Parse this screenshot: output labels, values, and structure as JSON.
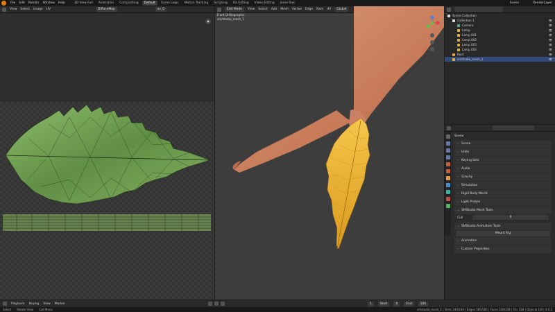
{
  "menu": [
    "File",
    "Edit",
    "Render",
    "Window",
    "Help"
  ],
  "workspaces": [
    "3D View Full",
    "Animation",
    "Compositing",
    "Default",
    "Game Logic",
    "Motion Tracking",
    "Scripting",
    "UV Editing",
    "Video Editing",
    "Jesse-Tool"
  ],
  "scene_label": "Scene",
  "view_layer": "RenderLayer",
  "uv_editor": {
    "menu": [
      "View",
      "Select",
      "Image",
      "UV"
    ],
    "image_name": "DiffuseMap",
    "uv_map": "uv_0"
  },
  "viewport": {
    "mode": "Edit Mode",
    "menu": [
      "View",
      "Select",
      "Add",
      "Mesh",
      "Vertex",
      "Edge",
      "Face",
      "UV"
    ],
    "orientation": "Global",
    "view_name": "Front Orthographic",
    "object_name": "sm/studio_mesh_1"
  },
  "outliner": {
    "rows": [
      {
        "label": "Scene Collection",
        "indent": 0
      },
      {
        "label": "Collection 1",
        "indent": 1
      },
      {
        "label": "Camera",
        "indent": 2
      },
      {
        "label": "Lamp",
        "indent": 2
      },
      {
        "label": "Lamp.001",
        "indent": 2
      },
      {
        "label": "Lamp.002",
        "indent": 2
      },
      {
        "label": "Lamp.003",
        "indent": 2
      },
      {
        "label": "Lamp.004",
        "indent": 2
      },
      {
        "label": "Root",
        "indent": 1
      },
      {
        "label": "smstudio_mesh_1",
        "indent": 1
      }
    ]
  },
  "properties": {
    "title": "Scene",
    "panels": [
      "Scene",
      "Units",
      "Keying Sets",
      "Audio",
      "Gravity",
      "Simulation",
      "Rigid Body World",
      "Light Probes",
      "SMStudio Mesh Tools"
    ],
    "cull_label": "Cull",
    "cull_value": "0",
    "anim_panel": "SMStudio Animation Tools",
    "mount_rig": "Mount Rig",
    "panels_after": [
      "Animation",
      "Custom Properties"
    ]
  },
  "timeline": {
    "items": [
      "Playback",
      "Keying",
      "View",
      "Marker"
    ],
    "current_frame": "1",
    "start_label": "Start",
    "start": "0",
    "end_label": "End",
    "end": "100"
  },
  "statusbar": {
    "left": [
      "Select",
      "Rotate View",
      "Call Menu"
    ],
    "right": "smstudio_mesh_1 | Verts 244/244 | Edges 585/585 | Faces 338/338 | Tris 338 | Objects 1/8 | 4.0.2"
  }
}
